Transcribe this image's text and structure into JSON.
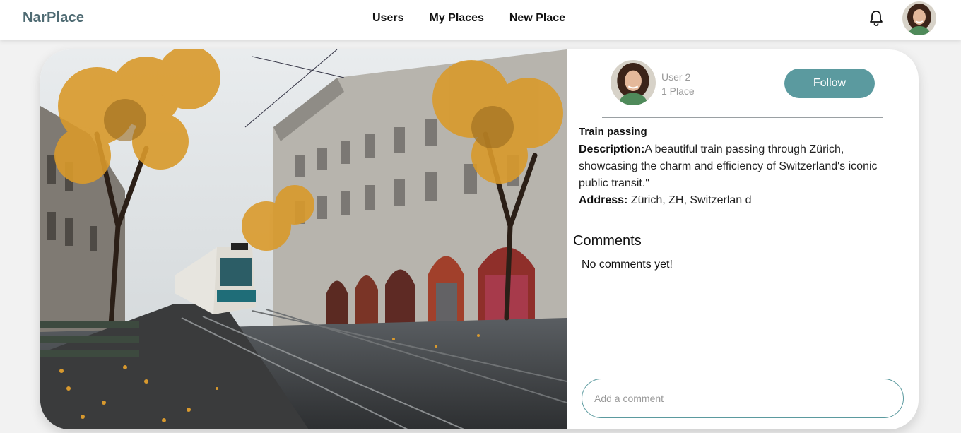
{
  "nav": {
    "brand": "NarPlace",
    "links": [
      "Users",
      "My Places",
      "New Place"
    ],
    "bell_icon": "bell-icon",
    "avatar_icon": "user-avatar"
  },
  "author": {
    "name": "User 2",
    "places": "1 Place",
    "follow_label": "Follow"
  },
  "place": {
    "title": "Train passing",
    "description_label": "Description:",
    "description": "A beautiful train passing through Zürich, showcasing the charm and efficiency of Switzerland's iconic public transit.\"",
    "address_label": "Address:",
    "address": " Zürich, ZH, Switzerlan d"
  },
  "comments": {
    "heading": "Comments",
    "empty_text": "No comments yet!",
    "placeholder": "Add a comment"
  },
  "colors": {
    "accent": "#5b9a9f",
    "brand": "#4f6b73"
  }
}
